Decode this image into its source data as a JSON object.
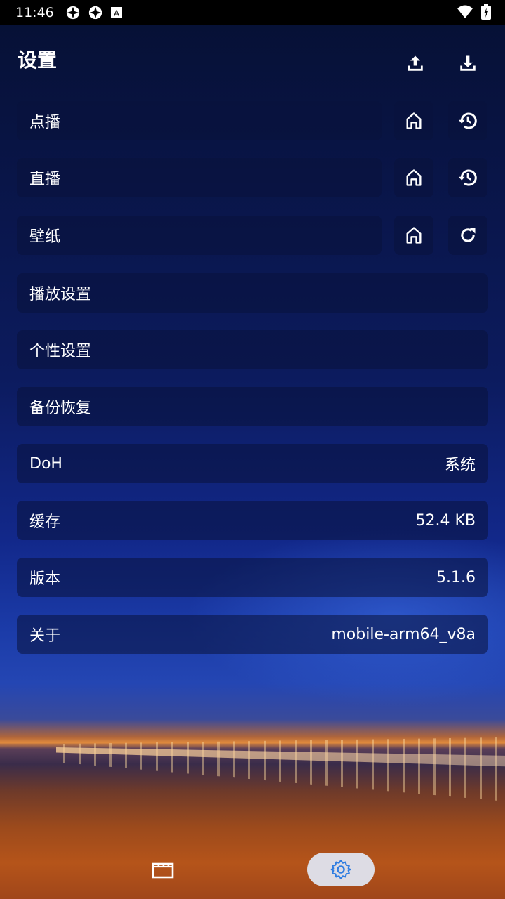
{
  "status_bar": {
    "time": "11:46"
  },
  "header": {
    "title": "设置",
    "upload_icon": "upload-icon",
    "download_icon": "download-icon"
  },
  "rows": {
    "vod": {
      "label": "点播"
    },
    "live": {
      "label": "直播"
    },
    "wallpaper": {
      "label": "壁纸"
    },
    "playback": {
      "label": "播放设置"
    },
    "personal": {
      "label": "个性设置"
    },
    "backup": {
      "label": "备份恢复"
    },
    "doh": {
      "label": "DoH",
      "value": "系统"
    },
    "cache": {
      "label": "缓存",
      "value": "52.4 KB"
    },
    "version": {
      "label": "版本",
      "value": "5.1.6"
    },
    "about": {
      "label": "关于",
      "value": "mobile-arm64_v8a"
    }
  },
  "bottom_nav": {
    "items": [
      "movie-icon",
      "gear-icon"
    ],
    "active": "gear-icon"
  },
  "colors": {
    "accent": "#2f7de1",
    "row_bg": "rgba(10,18,60,0.55)"
  }
}
